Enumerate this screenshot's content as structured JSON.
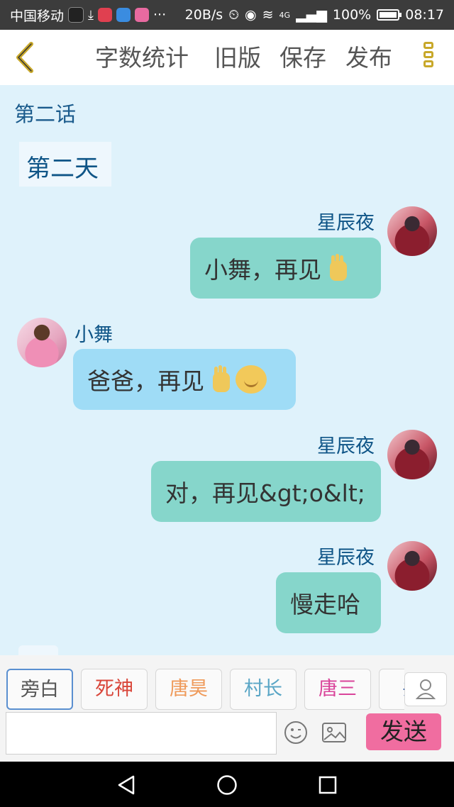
{
  "status_bar": {
    "carrier": "中国移动",
    "speed": "20B/s",
    "network": "4G",
    "battery": "100%",
    "time": "08:17",
    "more": "···"
  },
  "header": {
    "word_count": "字数统计",
    "old_version": "旧版",
    "save": "保存",
    "publish": "发布"
  },
  "chapter": {
    "title": "第二话",
    "day": "第二天"
  },
  "messages": [
    {
      "sender": "星辰夜",
      "text": "小舞，再见"
    },
    {
      "sender": "小舞",
      "text": "爸爸，再见"
    },
    {
      "sender": "星辰夜",
      "text": "对，再见&gt;o&lt;"
    },
    {
      "sender": "星辰夜",
      "text": "慢走哈"
    }
  ],
  "characters": [
    {
      "label": "旁白",
      "color": "#555555"
    },
    {
      "label": "死神",
      "color": "#d9463a"
    },
    {
      "label": "唐昊",
      "color": "#ef9a5a"
    },
    {
      "label": "村长",
      "color": "#5aa6c6"
    },
    {
      "label": "唐三",
      "color": "#d9449a"
    },
    {
      "label": "共",
      "color": "#1a4a9a"
    }
  ],
  "composer": {
    "input_value": "",
    "send_label": "发送"
  },
  "colors": {
    "accent_send": "#f06da0",
    "bubble_me": "#86d6cb",
    "bubble_other": "#9fdcf6",
    "name_color": "#0f5587"
  }
}
